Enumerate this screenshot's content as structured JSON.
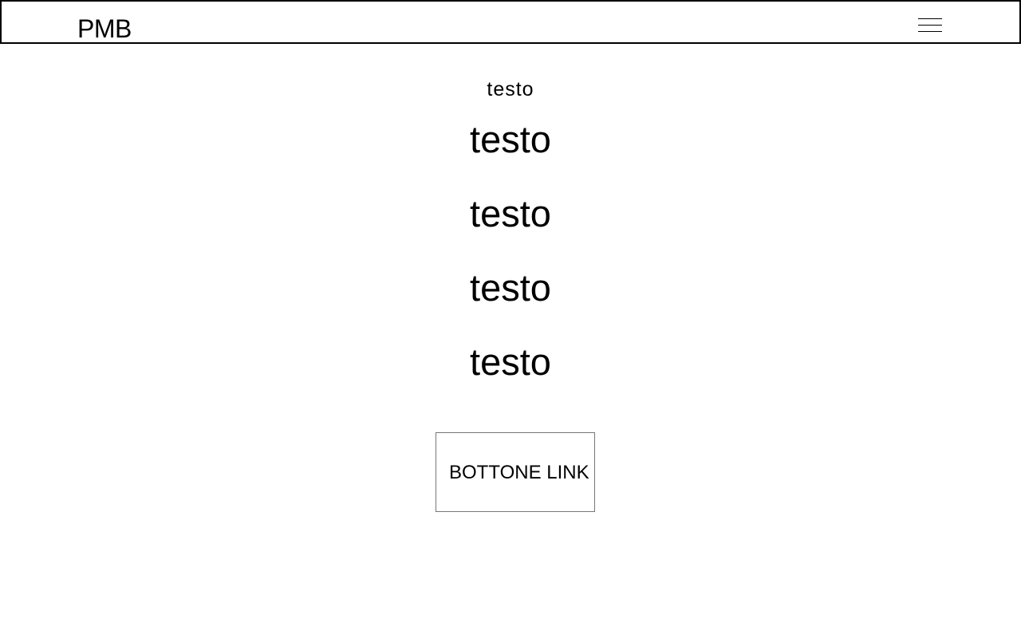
{
  "header": {
    "logo_text": "PMB",
    "menu_icon": "hamburger-menu-icon"
  },
  "main": {
    "eyebrow": "testo",
    "headings": [
      "testo",
      "testo",
      "testo",
      "testo"
    ],
    "button_label": "BOTTONE LINK"
  },
  "colors": {
    "text": "#000000",
    "background": "#ffffff",
    "button_border": "#777777"
  }
}
